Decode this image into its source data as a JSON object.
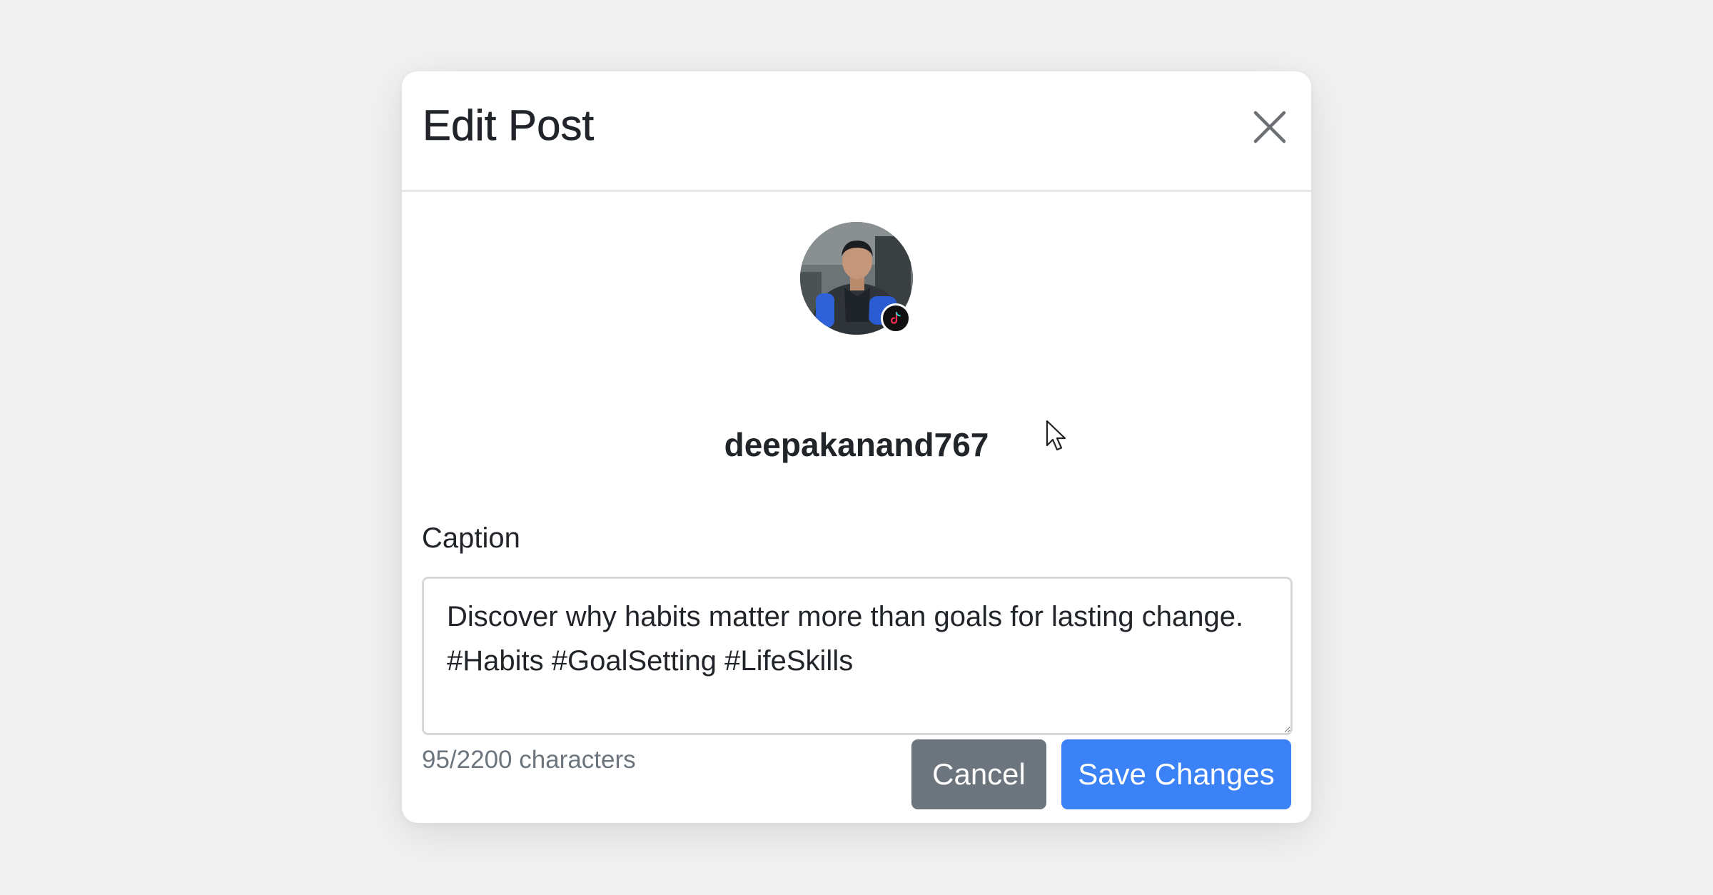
{
  "modal": {
    "title": "Edit Post",
    "close_icon": "close-icon"
  },
  "profile": {
    "username": "deepakanand767",
    "avatar_icon": "user-avatar-photo",
    "badge_icon": "tiktok-icon"
  },
  "caption": {
    "label": "Caption",
    "value": "Discover why habits matter more than goals for lasting change. #Habits #GoalSetting #LifeSkills",
    "char_count_text": "95/2200 characters"
  },
  "actions": {
    "cancel_label": "Cancel",
    "save_label": "Save Changes"
  },
  "colors": {
    "primary": "#3b82f6",
    "secondary": "#6c757d",
    "background": "#f1f1f2"
  }
}
